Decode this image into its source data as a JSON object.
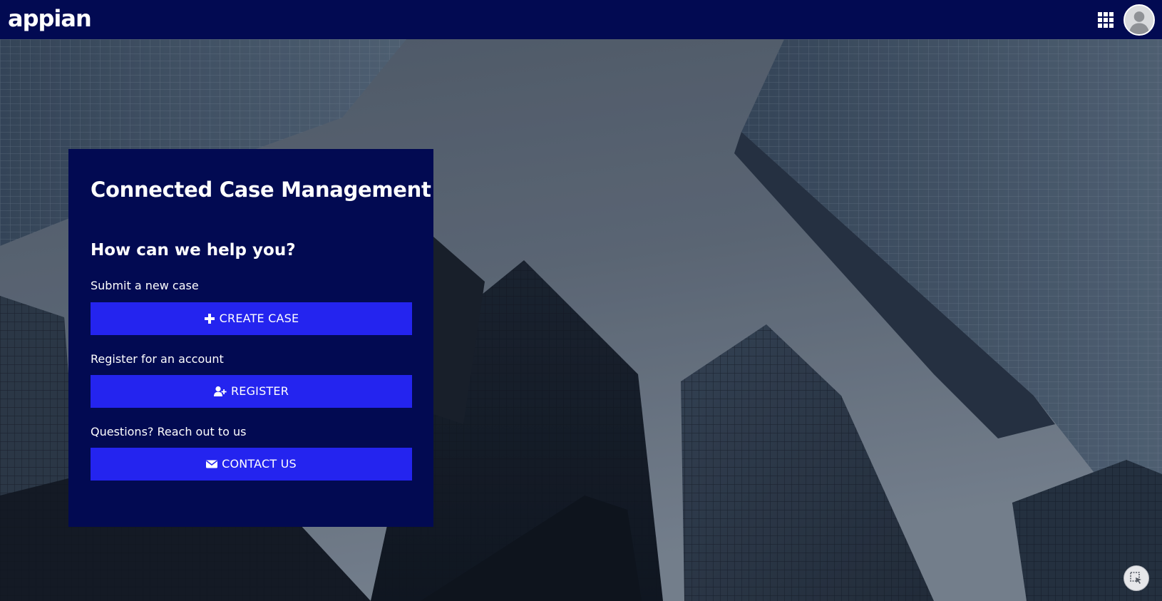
{
  "header": {
    "logo_text": "appian",
    "apps_icon": "grid-apps-icon",
    "avatar_icon": "user-avatar-icon"
  },
  "panel": {
    "title": "Connected Case Management",
    "subtitle": "How can we help you?",
    "sections": [
      {
        "label": "Submit a new case",
        "button_label": "CREATE CASE",
        "icon": "plus-icon"
      },
      {
        "label": "Register for an account",
        "button_label": "REGISTER",
        "icon": "user-plus-icon"
      },
      {
        "label": "Questions? Reach out to us",
        "button_label": "CONTACT US",
        "icon": "envelope-icon"
      }
    ]
  },
  "corner": {
    "icon": "cursor-select-icon"
  },
  "colors": {
    "header_bg": "#020a52",
    "panel_bg": "#020a52",
    "button_bg": "#2424ef",
    "text": "#ffffff"
  }
}
